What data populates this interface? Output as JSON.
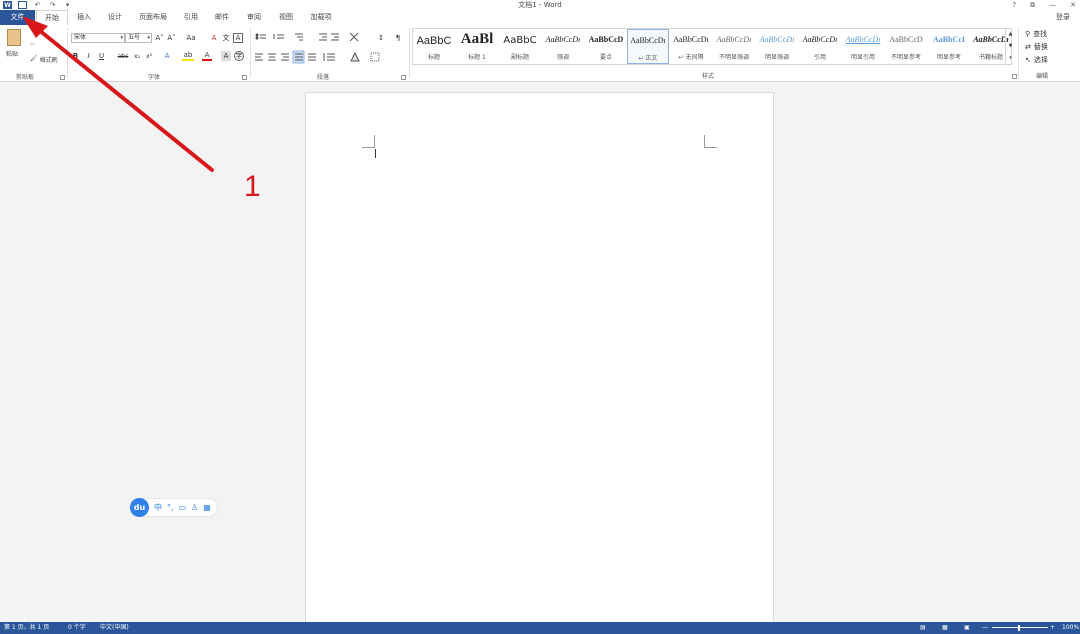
{
  "title_bar": {
    "doc_title": "文档1 - Word",
    "help": "?",
    "restore_ribbon": "⧉",
    "minimize": "—",
    "close": "✕"
  },
  "qat": {
    "word_icon": "W",
    "save": "🖫",
    "undo": "↶",
    "redo": "↷",
    "customize": "▾"
  },
  "tabs": [
    {
      "label": "文件"
    },
    {
      "label": "开始"
    },
    {
      "label": "插入"
    },
    {
      "label": "设计"
    },
    {
      "label": "页面布局"
    },
    {
      "label": "引用"
    },
    {
      "label": "邮件"
    },
    {
      "label": "审阅"
    },
    {
      "label": "视图"
    },
    {
      "label": "加载项"
    }
  ],
  "login": "登录",
  "clipboard": {
    "paste": "粘贴",
    "format_painter": "格式刷",
    "label": "剪贴板"
  },
  "font": {
    "name": "宋体",
    "size": "五号",
    "grow": "A˄",
    "shrink": "A˅",
    "case": "Aa",
    "clear": "A",
    "phonetic": "文",
    "border": "A",
    "bold": "B",
    "italic": "I",
    "underline": "U",
    "strike": "abc",
    "sub": "x₂",
    "sup": "x²",
    "effects": "A",
    "highlight": "ab",
    "color": "A",
    "shade": "A",
    "circle": "字",
    "label": "字体"
  },
  "paragraph": {
    "label": "段落",
    "sort": "↕",
    "show_marks": "¶"
  },
  "styles": {
    "label": "样式",
    "items": [
      {
        "sample": "AaBbC",
        "name": "标题"
      },
      {
        "sample": "AaBl",
        "name": "标题 1"
      },
      {
        "sample": "AaBbC",
        "name": "副标题"
      },
      {
        "sample": "AaBbCcDı",
        "name": "强调"
      },
      {
        "sample": "AaBbCcD",
        "name": "要点"
      },
      {
        "sample": "AaBbCcDı",
        "name": "↵ 正文"
      },
      {
        "sample": "AaBbCcDı",
        "name": "↵ 无间隔"
      },
      {
        "sample": "AaBbCcDı",
        "name": "不明显强调"
      },
      {
        "sample": "AaBbCcDı",
        "name": "明显强调"
      },
      {
        "sample": "AaBbCcDı",
        "name": "引用"
      },
      {
        "sample": "AaBbCcDı",
        "name": "明显引用"
      },
      {
        "sample": "AaBbCcD",
        "name": "不明显参考"
      },
      {
        "sample": "AaBbCcI",
        "name": "明显参考"
      },
      {
        "sample": "AaBbCcDı",
        "name": "书籍标题"
      }
    ]
  },
  "editing": {
    "find": "查找",
    "replace": "替换",
    "select": "选择",
    "label": "编辑"
  },
  "status": {
    "page": "第 1 页，共 1 页",
    "words": "0 个字",
    "lang": "中文(中国)",
    "zoom": "100%"
  },
  "ime": {
    "logo": "du",
    "mode": "中",
    "punct": "°,",
    "kbd": "▭",
    "user": "♙",
    "grid": "▦"
  },
  "annotation": {
    "number": "1",
    "color": "#d8171a"
  }
}
